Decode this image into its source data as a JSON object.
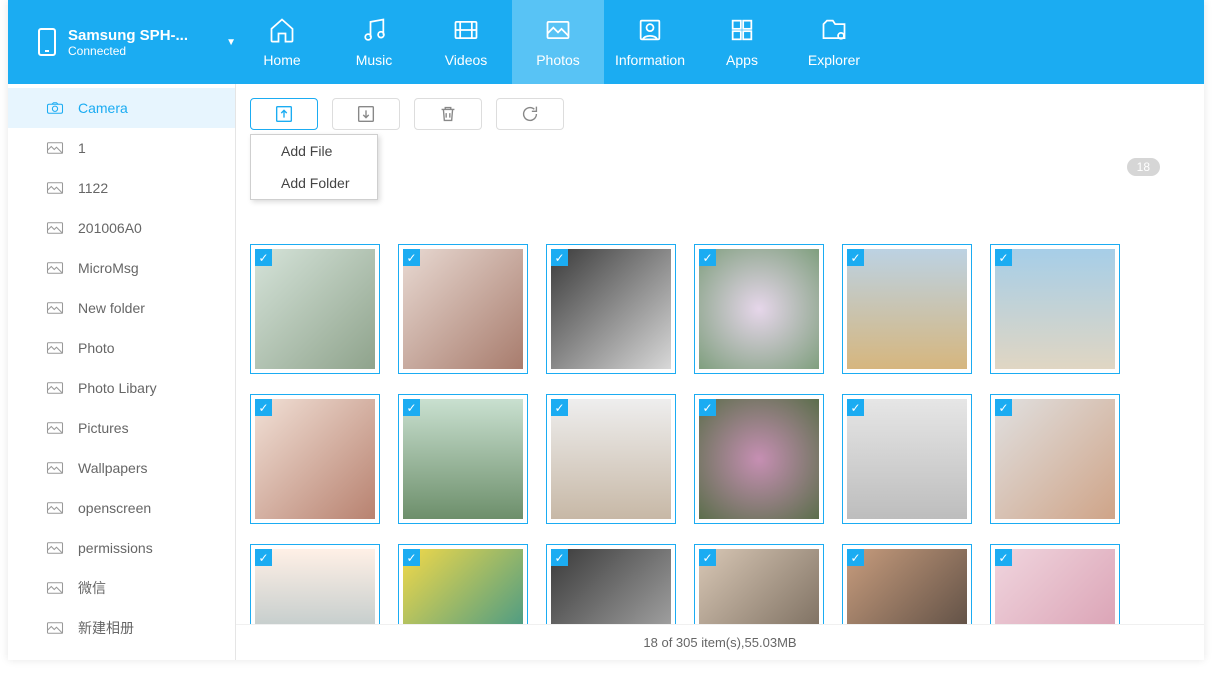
{
  "device": {
    "name": "Samsung SPH-...",
    "status": "Connected"
  },
  "nav": [
    {
      "id": "home",
      "label": "Home"
    },
    {
      "id": "music",
      "label": "Music"
    },
    {
      "id": "videos",
      "label": "Videos"
    },
    {
      "id": "photos",
      "label": "Photos",
      "active": true
    },
    {
      "id": "information",
      "label": "Information"
    },
    {
      "id": "apps",
      "label": "Apps"
    },
    {
      "id": "explorer",
      "label": "Explorer"
    }
  ],
  "sidebar": {
    "items": [
      {
        "label": "Camera",
        "active": true,
        "icon": "camera"
      },
      {
        "label": "1"
      },
      {
        "label": "1122"
      },
      {
        "label": "201006A0"
      },
      {
        "label": "MicroMsg"
      },
      {
        "label": "New folder"
      },
      {
        "label": "Photo"
      },
      {
        "label": "Photo Libary"
      },
      {
        "label": "Pictures"
      },
      {
        "label": "Wallpapers"
      },
      {
        "label": "openscreen"
      },
      {
        "label": "permissions"
      },
      {
        "label": "微信"
      },
      {
        "label": "新建相册"
      }
    ]
  },
  "dropdown": {
    "add_file": "Add File",
    "add_folder": "Add Folder"
  },
  "badge": "18",
  "grid": {
    "rows": [
      [
        {
          "sel": true
        },
        {
          "sel": true
        },
        {
          "sel": true
        },
        {
          "sel": true
        },
        {
          "sel": true
        },
        {
          "sel": true
        }
      ],
      [
        {
          "sel": true
        },
        {
          "sel": true
        },
        {
          "sel": true
        },
        {
          "sel": true
        },
        {
          "sel": true
        },
        {
          "sel": true
        }
      ],
      [
        {
          "sel": true
        },
        {
          "sel": true
        },
        {
          "sel": true
        },
        {
          "sel": true
        },
        {
          "sel": true
        },
        {
          "sel": true
        }
      ]
    ]
  },
  "status": "18 of 305 item(s),55.03MB"
}
